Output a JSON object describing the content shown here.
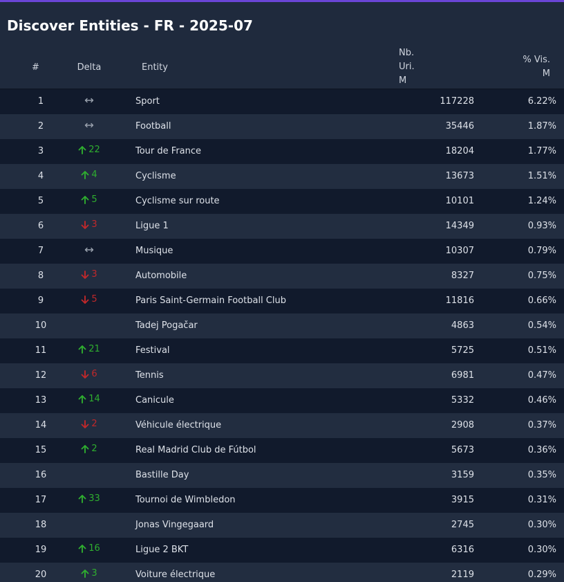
{
  "title": "Discover Entities - FR - 2025-07",
  "columns": {
    "num": "#",
    "delta": "Delta",
    "entity": "Entity",
    "uri": "Nb. Uri.",
    "uri_sub": "M",
    "vis": "% Vis.",
    "vis_sub": "M"
  },
  "colors": {
    "up": "#2fae2f",
    "down": "#c0282a",
    "same": "#9aa2ae",
    "accent": "#6a45d6"
  },
  "rows": [
    {
      "num": "1",
      "dir": "same",
      "delta": "",
      "entity": "Sport",
      "uri": "117228",
      "vis": "6.22%"
    },
    {
      "num": "2",
      "dir": "same",
      "delta": "",
      "entity": "Football",
      "uri": "35446",
      "vis": "1.87%"
    },
    {
      "num": "3",
      "dir": "up",
      "delta": "22",
      "entity": "Tour de France",
      "uri": "18204",
      "vis": "1.77%"
    },
    {
      "num": "4",
      "dir": "up",
      "delta": "4",
      "entity": "Cyclisme",
      "uri": "13673",
      "vis": "1.51%"
    },
    {
      "num": "5",
      "dir": "up",
      "delta": "5",
      "entity": "Cyclisme sur route",
      "uri": "10101",
      "vis": "1.24%"
    },
    {
      "num": "6",
      "dir": "down",
      "delta": "3",
      "entity": "Ligue 1",
      "uri": "14349",
      "vis": "0.93%"
    },
    {
      "num": "7",
      "dir": "same",
      "delta": "",
      "entity": "Musique",
      "uri": "10307",
      "vis": "0.79%"
    },
    {
      "num": "8",
      "dir": "down",
      "delta": "3",
      "entity": "Automobile",
      "uri": "8327",
      "vis": "0.75%"
    },
    {
      "num": "9",
      "dir": "down",
      "delta": "5",
      "entity": "Paris Saint-Germain Football Club",
      "uri": "11816",
      "vis": "0.66%"
    },
    {
      "num": "10",
      "dir": "none",
      "delta": "",
      "entity": "Tadej Pogačar",
      "uri": "4863",
      "vis": "0.54%"
    },
    {
      "num": "11",
      "dir": "up",
      "delta": "21",
      "entity": "Festival",
      "uri": "5725",
      "vis": "0.51%"
    },
    {
      "num": "12",
      "dir": "down",
      "delta": "6",
      "entity": "Tennis",
      "uri": "6981",
      "vis": "0.47%"
    },
    {
      "num": "13",
      "dir": "up",
      "delta": "14",
      "entity": "Canicule",
      "uri": "5332",
      "vis": "0.46%"
    },
    {
      "num": "14",
      "dir": "down",
      "delta": "2",
      "entity": "Véhicule électrique",
      "uri": "2908",
      "vis": "0.37%"
    },
    {
      "num": "15",
      "dir": "up",
      "delta": "2",
      "entity": "Real Madrid Club de Fútbol",
      "uri": "5673",
      "vis": "0.36%"
    },
    {
      "num": "16",
      "dir": "none",
      "delta": "",
      "entity": "Bastille Day",
      "uri": "3159",
      "vis": "0.35%"
    },
    {
      "num": "17",
      "dir": "up",
      "delta": "33",
      "entity": "Tournoi de Wimbledon",
      "uri": "3915",
      "vis": "0.31%"
    },
    {
      "num": "18",
      "dir": "none",
      "delta": "",
      "entity": "Jonas Vingegaard",
      "uri": "2745",
      "vis": "0.30%"
    },
    {
      "num": "19",
      "dir": "up",
      "delta": "16",
      "entity": "Ligue 2 BKT",
      "uri": "6316",
      "vis": "0.30%"
    },
    {
      "num": "20",
      "dir": "up",
      "delta": "3",
      "entity": "Voiture électrique",
      "uri": "2119",
      "vis": "0.29%"
    }
  ]
}
